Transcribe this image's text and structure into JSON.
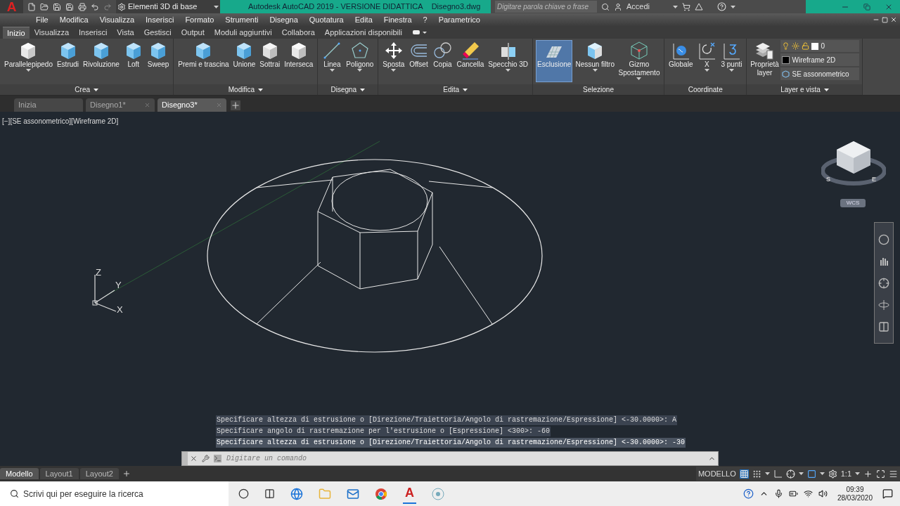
{
  "title_bar": {
    "logo": "A",
    "workspace": "Elementi 3D di base",
    "title": "Autodesk AutoCAD 2019 - VERSIONE DIDATTICA",
    "file": "Disegno3.dwg",
    "search_placeholder": "Digitare parola chiave o frase",
    "sign_in": "Accedi"
  },
  "menu_bar": [
    "File",
    "Modifica",
    "Visualizza",
    "Inserisci",
    "Formato",
    "Strumenti",
    "Disegna",
    "Quotatura",
    "Edita",
    "Finestra",
    "?",
    "Parametrico"
  ],
  "ribbon_tabs": [
    {
      "label": "Inizio",
      "selected": true
    },
    {
      "label": "Visualizza",
      "selected": false
    },
    {
      "label": "Inserisci",
      "selected": false
    },
    {
      "label": "Vista",
      "selected": false
    },
    {
      "label": "Gestisci",
      "selected": false
    },
    {
      "label": "Output",
      "selected": false
    },
    {
      "label": "Moduli aggiuntivi",
      "selected": false
    },
    {
      "label": "Collabora",
      "selected": false
    },
    {
      "label": "Applicazioni disponibili",
      "selected": false
    }
  ],
  "ribbon_panels": [
    {
      "title": "Crea",
      "title_menu": true,
      "tools": [
        {
          "label": "Parallelepipedo",
          "dropdown": true,
          "on": false
        },
        {
          "label": "Estrudi",
          "dropdown": false,
          "on": false
        },
        {
          "label": "Rivoluzione",
          "dropdown": false,
          "on": false
        },
        {
          "label": "Loft",
          "dropdown": false,
          "on": false
        },
        {
          "label": "Sweep",
          "dropdown": false,
          "on": false
        }
      ]
    },
    {
      "title": "Modifica",
      "title_menu": true,
      "tools": [
        {
          "label": "Premi e trascina",
          "dropdown": false,
          "on": false
        },
        {
          "label": "Unione",
          "dropdown": false,
          "on": false
        },
        {
          "label": "Sottrai",
          "dropdown": false,
          "on": false
        },
        {
          "label": "Interseca",
          "dropdown": false,
          "on": false
        }
      ]
    },
    {
      "title": "Disegna",
      "title_menu": true,
      "tools": [
        {
          "label": "Linea",
          "dropdown": true,
          "on": false
        },
        {
          "label": "Poligono",
          "dropdown": true,
          "on": false
        }
      ]
    },
    {
      "title": "Edita",
      "title_menu": true,
      "tools": [
        {
          "label": "Sposta",
          "dropdown": true,
          "on": false
        },
        {
          "label": "Offset",
          "dropdown": false,
          "on": false
        },
        {
          "label": "Copia",
          "dropdown": false,
          "on": false
        },
        {
          "label": "Cancella",
          "dropdown": false,
          "on": false
        },
        {
          "label": "Specchio 3D",
          "dropdown": true,
          "on": false
        }
      ]
    },
    {
      "title": "Selezione",
      "title_menu": false,
      "tools": [
        {
          "label": "Esclusione",
          "dropdown": false,
          "on": true
        },
        {
          "label": "Nessun filtro",
          "dropdown": true,
          "on": false
        },
        {
          "label": "Gizmo Spostamento",
          "dropdown": true,
          "on": false
        }
      ]
    },
    {
      "title": "Coordinate",
      "title_menu": false,
      "tools": [
        {
          "label": "Globale",
          "dropdown": false,
          "on": false
        },
        {
          "label": "X",
          "dropdown": true,
          "on": false
        },
        {
          "label": "3 punti",
          "dropdown": true,
          "on": false
        }
      ]
    },
    {
      "title": "Layer e vista",
      "title_menu": true,
      "tools": [
        {
          "label": "Proprietà layer",
          "dropdown": false,
          "on": false
        }
      ]
    }
  ],
  "layer_controls": {
    "layer": "0",
    "visual_style": "Wireframe 2D",
    "view": "SE assonometrico"
  },
  "doc_tabs": [
    {
      "label": "Inizia",
      "selected": false,
      "closable": false
    },
    {
      "label": "Disegno1*",
      "selected": false,
      "closable": true
    },
    {
      "label": "Disegno3*",
      "selected": true,
      "closable": true
    }
  ],
  "viewport": {
    "label": "[−][SE assonometrico][Wireframe 2D]",
    "ucs": {
      "z": "Z",
      "y": "Y",
      "x": "X"
    },
    "viewcube": {
      "compass": [
        "S",
        "E"
      ],
      "wcs": "WCS"
    }
  },
  "command_history": [
    "Specificare altezza di estrusione o [Direzione/Traiettoria/Angolo di rastremazione/Espressione] <-30.0000>: A",
    "Specificare angolo di rastremazione per l'estrusione o [Espressione] <300>: -60",
    "Specificare altezza di estrusione o [Direzione/Traiettoria/Angolo di rastremazione/Espressione] <-30.0000>: -30"
  ],
  "command_line": {
    "placeholder": "Digitare un comando"
  },
  "layout_tabs": [
    {
      "label": "Modello",
      "selected": true
    },
    {
      "label": "Layout1",
      "selected": false
    },
    {
      "label": "Layout2",
      "selected": false
    }
  ],
  "status_bar": {
    "space": "MODELLO",
    "scale": "1:1"
  },
  "taskbar": {
    "search": "Scrivi qui per eseguire la ricerca",
    "app_logo": "A",
    "time": "09:39",
    "date": "28/03/2020"
  }
}
